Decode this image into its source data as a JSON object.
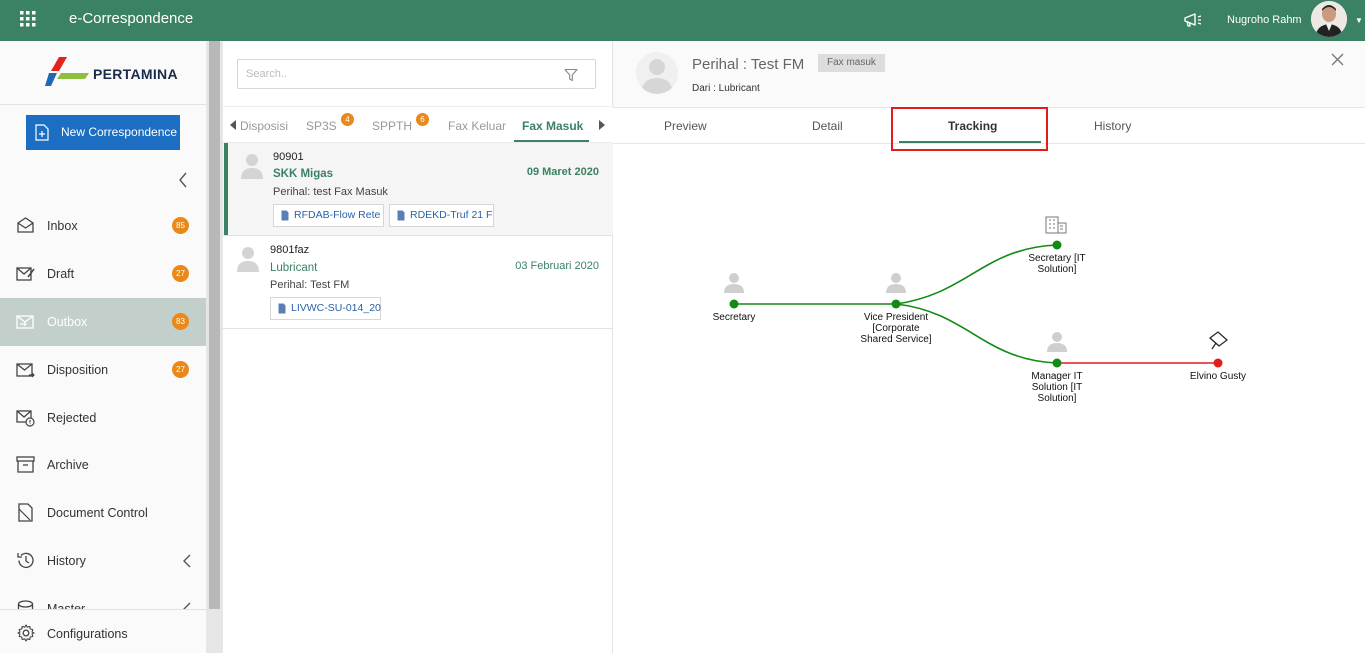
{
  "app": {
    "title": "e-Correspondence"
  },
  "user": {
    "name": "Nugroho Rahm"
  },
  "logo": {
    "text": "PERTAMINA"
  },
  "sidebar": {
    "new_button": "New Correspondence",
    "items": [
      {
        "label": "Inbox",
        "badge": "85"
      },
      {
        "label": "Draft",
        "badge": "27"
      },
      {
        "label": "Outbox",
        "badge": "83"
      },
      {
        "label": "Disposition",
        "badge": "27"
      },
      {
        "label": "Rejected",
        "badge": ""
      },
      {
        "label": "Archive",
        "badge": ""
      },
      {
        "label": "Document Control",
        "badge": ""
      },
      {
        "label": "History",
        "badge": ""
      },
      {
        "label": "Master",
        "badge": ""
      }
    ],
    "config_label": "Configurations"
  },
  "list": {
    "search_placeholder": "Search..",
    "tabs": [
      {
        "label": "Disposisi",
        "badge": ""
      },
      {
        "label": "SP3S",
        "badge": "4"
      },
      {
        "label": "SPPTH",
        "badge": "6"
      },
      {
        "label": "Fax Keluar",
        "badge": ""
      },
      {
        "label": "Fax Masuk",
        "badge": ""
      }
    ],
    "items": [
      {
        "id": "90901",
        "from": "SKK Migas",
        "date": "09 Maret 2020",
        "subject": "Perihal: test Fax Masuk",
        "attachments": [
          "RFDAB-Flow Rete",
          "RDEKD-Truf 21 F"
        ]
      },
      {
        "id": "9801faz",
        "from": "Lubricant",
        "date": "03 Februari 2020",
        "subject": "Perihal: Test FM",
        "attachments": [
          "LIVWC-SU-014_20"
        ]
      }
    ]
  },
  "detail": {
    "subject": "Perihal : Test FM",
    "tag": "Fax masuk",
    "from": "Dari : Lubricant",
    "tabs": [
      "Preview",
      "Detail",
      "Tracking",
      "History"
    ],
    "active_tab": "Tracking",
    "colors": {
      "done": "#138a13",
      "pending": "#e01d1d",
      "highlight": "#e01d1d"
    },
    "tracking_nodes": [
      {
        "label_lines": [
          "Secretary"
        ],
        "icon": "person-icon",
        "status": "done"
      },
      {
        "label_lines": [
          "Vice President",
          "[Corporate",
          "Shared Service]"
        ],
        "icon": "person-icon",
        "status": "done"
      },
      {
        "label_lines": [
          "Secretary [IT",
          "Solution]"
        ],
        "icon": "building-icon",
        "status": "done"
      },
      {
        "label_lines": [
          "Manager IT",
          "Solution [IT",
          "Solution]"
        ],
        "icon": "person-icon",
        "status": "done"
      },
      {
        "label_lines": [
          "Elvino Gusty"
        ],
        "icon": "flag-icon",
        "status": "pending"
      }
    ]
  }
}
